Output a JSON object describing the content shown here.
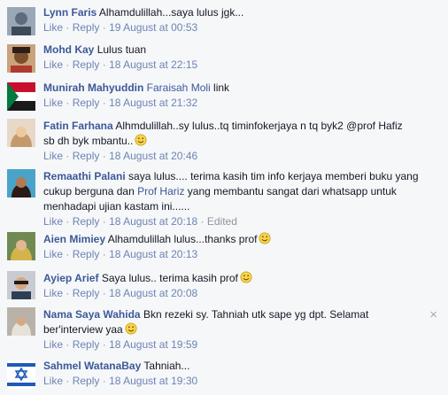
{
  "actions": {
    "like": "Like",
    "reply": "Reply",
    "dot": "·"
  },
  "comments": [
    {
      "author": "Lynn Faris",
      "text": "Alhamdulillah...saya lulus jgk...",
      "time": "19 August at 00:53"
    },
    {
      "author": "Mohd Kay",
      "text": "Lulus tuan",
      "time": "18 August at 22:15"
    },
    {
      "author": "Munirah Mahyuddin",
      "mention": "Faraisah Moli",
      "text": "link",
      "time": "18 August at 21:32"
    },
    {
      "author": "Fatin Farhana",
      "text": "Alhmdulillah..sy lulus..tq timinfokerjaya n tq byk2 @prof Hafiz sb dh byk mbantu..",
      "time": "18 August at 20:46"
    },
    {
      "author": "Remaathi Palani",
      "text_a": "saya lulus.... terima kasih tim info kerjaya memberi buku yang cukup berguna dan",
      "mention": "Prof Hariz",
      "text_b": "yang membantu sangat dari whatsapp untuk menhadapi ujian kastam ini......",
      "time": "18 August at 20:18",
      "edited": "Edited"
    },
    {
      "author": "Aien Mimiey",
      "text": "Alhamdulillah lulus...thanks prof",
      "time": "18 August at 20:13"
    },
    {
      "author": "Ayiep Arief",
      "text": "Saya lulus.. terima kasih prof",
      "time": "18 August at 20:08"
    },
    {
      "author": "Nama Saya Wahida",
      "text": "Bkn rezeki sy. Tahniah utk sape yg dpt. Selamat ber'interview yaa",
      "time": "18 August at 19:59"
    },
    {
      "author": "Sahmel WatanaBay",
      "text": "Tahniah...",
      "time": "18 August at 19:30"
    }
  ],
  "close_glyph": "×",
  "colors": {
    "link": "#3b5998",
    "meta": "#90949c",
    "background": "#f6f7f9"
  }
}
